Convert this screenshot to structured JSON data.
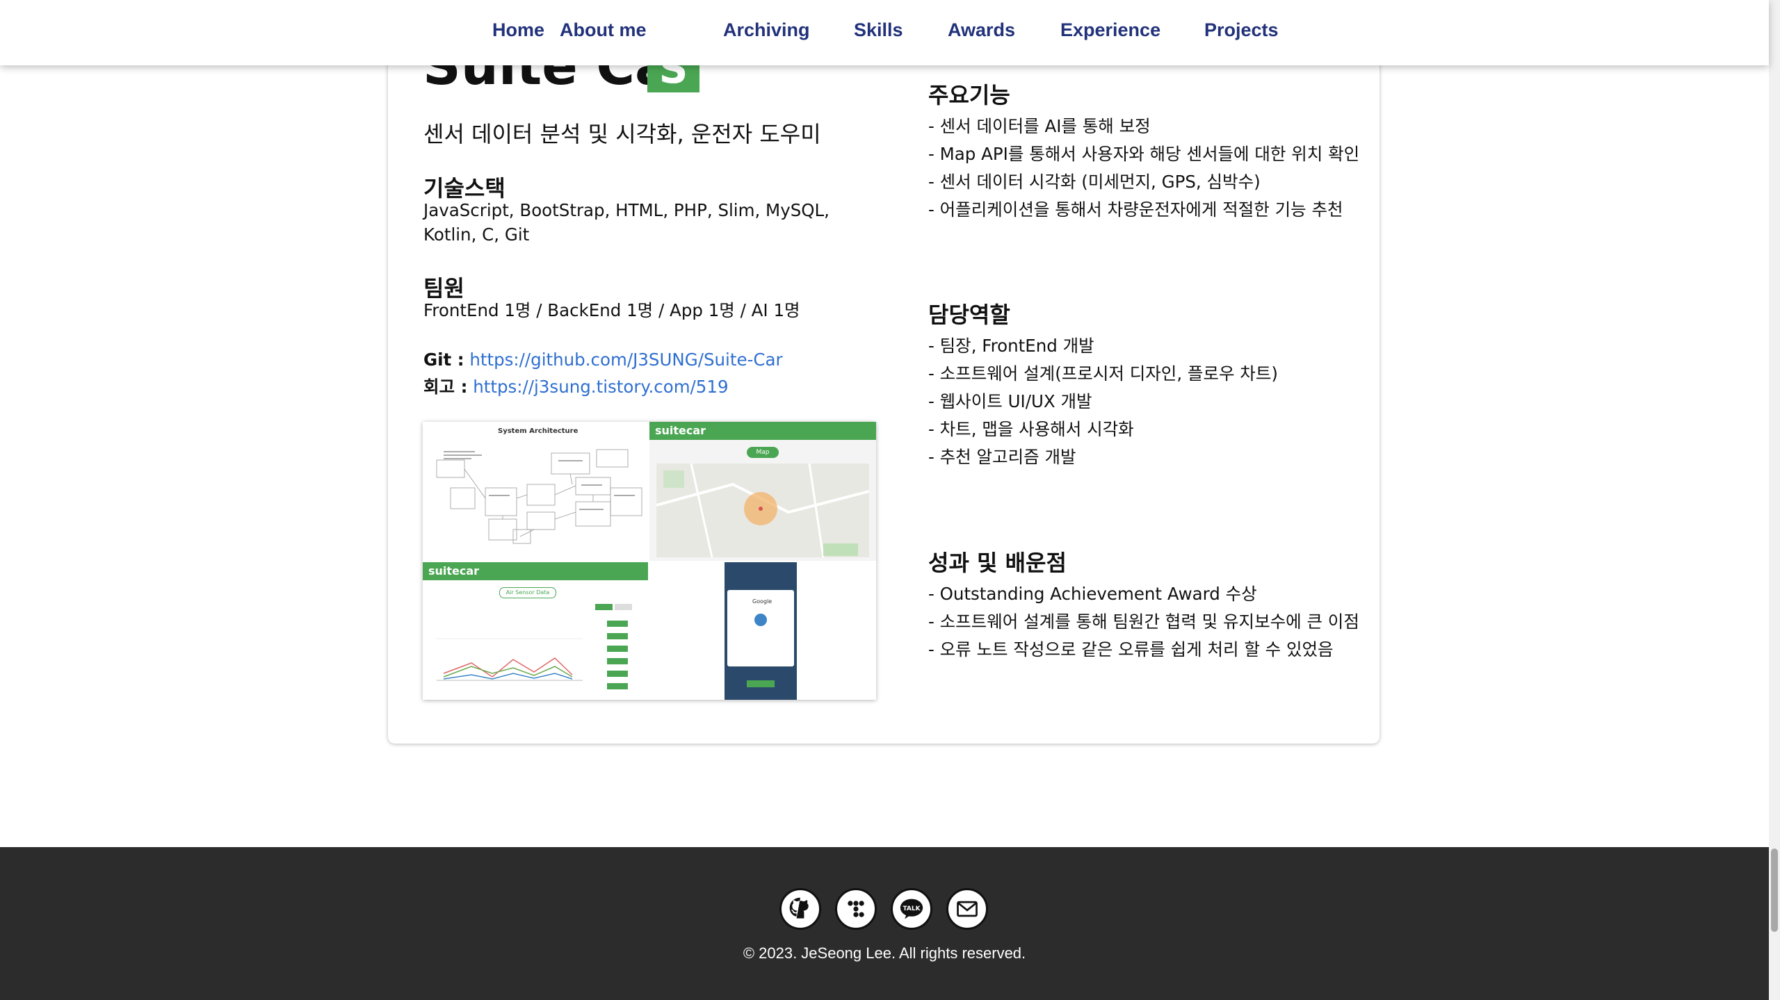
{
  "nav": {
    "items": [
      "Home",
      "About me",
      "Archiving",
      "Skills",
      "Awards",
      "Experience",
      "Projects"
    ]
  },
  "project": {
    "title": "Suite Car",
    "badge": "S",
    "tagline": "센서 데이터 분석 및 시각화, 운전자 도우미",
    "stack_heading": "기술스택",
    "stack": "JavaScript, BootStrap, HTML, PHP, Slim, MySQL, Kotlin, C, Git",
    "team_heading": "팀원",
    "team": "FrontEnd 1명 / BackEnd 1명 / App 1명 / AI 1명",
    "git_label": "Git :",
    "git_url": "https://github.com/J3SUNG/Suite-Car",
    "review_label": "회고 :",
    "review_url": "https://j3sung.tistory.com/519",
    "features_heading": "주요기능",
    "features": [
      "- 센서 데이터를 AI를 통해 보정",
      "- Map API를 통해서 사용자와 해당 센서들에 대한 위치 확인",
      "- 센서 데이터 시각화 (미세먼지, GPS, 심박수)",
      "- 어플리케이션을 통해서 차량운전자에게 적절한 기능 추천"
    ],
    "roles_heading": "담당역할",
    "roles": [
      "- 팀장, FrontEnd 개발",
      "- 소프트웨어 설계(프로시저 디자인, 플로우 차트)",
      "- 웹사이트 UI/UX 개발",
      "- 차트, 맵을 사용해서 시각화",
      "- 추천 알고리즘 개발"
    ],
    "results_heading": "성과 및 배운점",
    "results": [
      "- Outstanding Achievement Award 수상",
      "- 소프트웨어 설계를 통해 팀원간 협력 및 유지보수에 큰 이점",
      "- 오류 노트 작성으로 같은 오류를 쉽게 처리 할 수 있었음"
    ],
    "screens": {
      "arch_title": "System Architecture",
      "brand": "suitecar",
      "map_label": "Map",
      "chart_label": "Air Sensor Data",
      "google": "Google"
    }
  },
  "footer": {
    "icons": [
      "github-icon",
      "tistory-icon",
      "kakaotalk-icon",
      "mail-icon"
    ],
    "talk": "TALK",
    "copyright": "© 2023. JeSeong Lee. All rights reserved."
  },
  "colors": {
    "nav_text": "#22327a",
    "accent_green": "#4aa653",
    "link": "#2f6fd0",
    "footer_bg": "#2c2c2c"
  }
}
